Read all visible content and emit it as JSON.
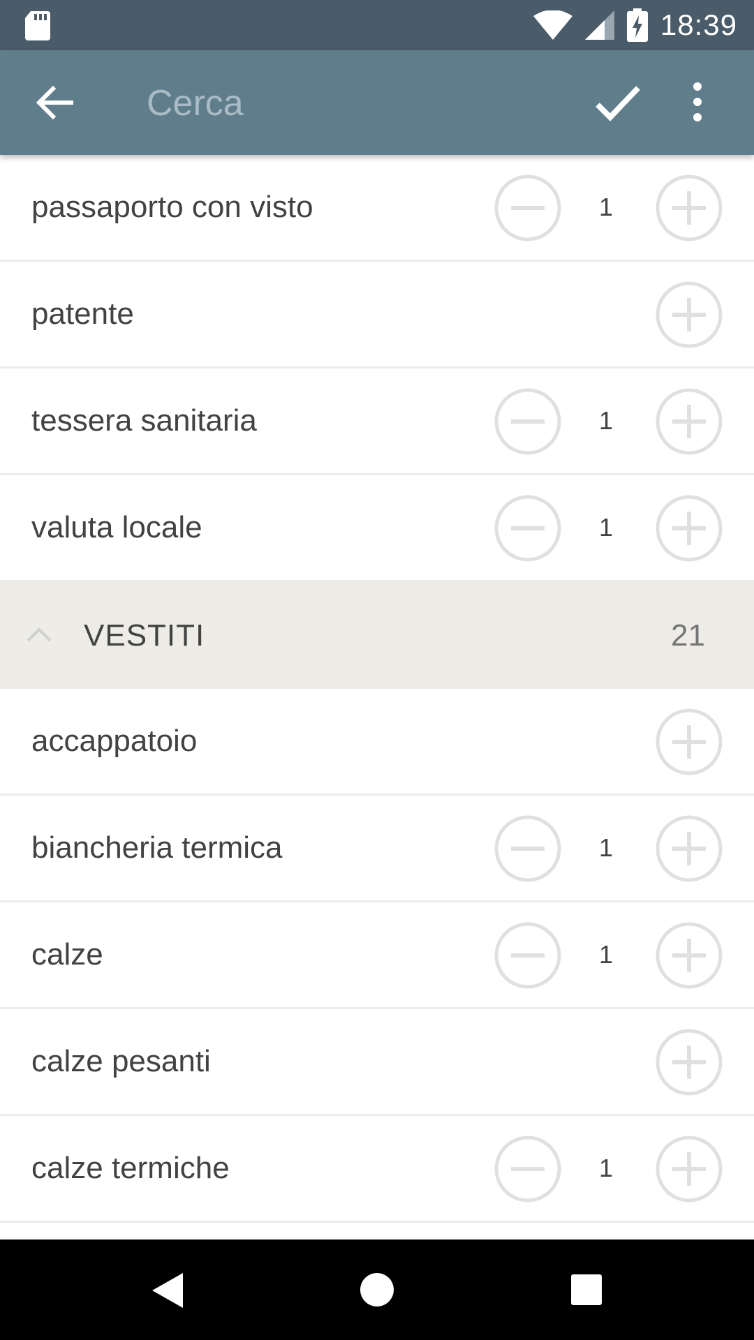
{
  "status_bar": {
    "time": "18:39",
    "icons": [
      "sd-card-icon",
      "wifi-icon",
      "signal-icon",
      "battery-charging-icon"
    ]
  },
  "app_bar": {
    "back_icon": "arrow-left-icon",
    "search_placeholder": "Cerca",
    "confirm_icon": "check-icon",
    "menu_icon": "more-vertical-icon"
  },
  "items_top": [
    {
      "label": "passaporto con visto",
      "quantity": "1"
    },
    {
      "label": "patente",
      "quantity": ""
    },
    {
      "label": "tessera sanitaria",
      "quantity": "1"
    },
    {
      "label": "valuta locale",
      "quantity": "1"
    }
  ],
  "section": {
    "title": "VESTITI",
    "count": "21",
    "icon": "chevron-up-icon"
  },
  "items_section": [
    {
      "label": "accappatoio",
      "quantity": ""
    },
    {
      "label": "biancheria termica",
      "quantity": "1"
    },
    {
      "label": "calze",
      "quantity": "1"
    },
    {
      "label": "calze pesanti",
      "quantity": ""
    },
    {
      "label": "calze termiche",
      "quantity": "1"
    }
  ],
  "nav_bar": {
    "icons": [
      "nav-back-icon",
      "nav-home-icon",
      "nav-recents-icon"
    ]
  },
  "colors": {
    "status_bar": "#4a5c69",
    "app_bar": "#607d8b",
    "section_bg": "#eeece7",
    "button_ring": "#e0e0e0"
  }
}
